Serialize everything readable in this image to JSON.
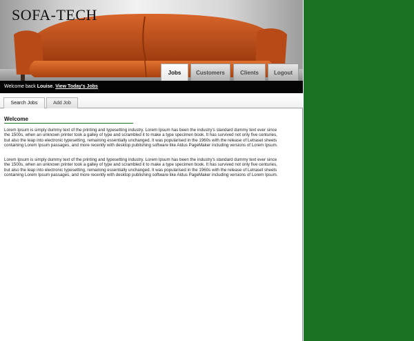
{
  "header": {
    "site_title": "SOFA-TECH"
  },
  "nav": {
    "jobs": "Jobs",
    "customers": "Customers",
    "clients": "Clients",
    "logout": "Logout"
  },
  "welcome_bar": {
    "prefix": "Welcome back ",
    "user": "Louise",
    "separator": ". ",
    "link": "View Today's Jobs"
  },
  "subtabs": {
    "search_jobs": "Search Jobs",
    "add_job": "Add Job"
  },
  "content": {
    "title": "Welcome",
    "paragraphs": [
      "Lorem Ipsum is simply dummy text of the printing and typesetting industry. Lorem Ipsum has been the industry's standard dummy text ever since the 1500s, when an unknown printer took a galley of type and scrambled it to make a type specimen book. It has survived not only five centuries, but also the leap into electronic typesetting, remaining essentially unchanged. It was popularised in the 1960s with the release of Letraset sheets containing Lorem Ipsum passages, and more recently with desktop publishing software like Aldus PageMaker including versions of Lorem Ipsum.",
      "Lorem Ipsum is simply dummy text of the printing and typesetting industry. Lorem Ipsum has been the industry's standard dummy text ever since the 1500s, when an unknown printer took a galley of type and scrambled it to make a type specimen book. It has survived not only five centuries, but also the leap into electronic typesetting, remaining essentially unchanged. It was popularised in the 1960s with the release of Letraset sheets containing Lorem Ipsum passages, and more recently with desktop publishing software like Aldus PageMaker including versions of Lorem Ipsum."
    ]
  },
  "colors": {
    "side_panel": "#1b7222",
    "welcome_bar": "#050505",
    "accent_rule": "#1b7222",
    "sofa": "#c4521c"
  }
}
